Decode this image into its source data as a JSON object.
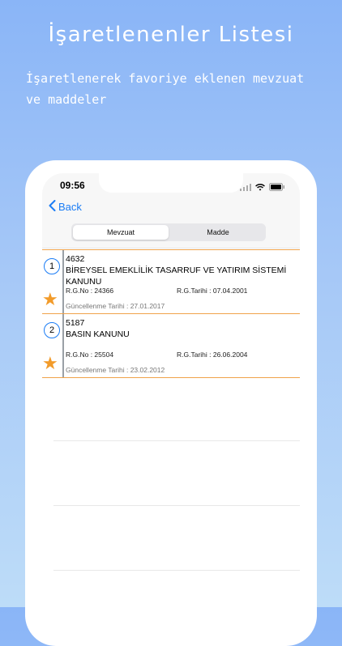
{
  "promo": {
    "title": "İşaretlenenler Listesi",
    "subtitle": "İşaretlenerek favoriye eklenen mevzuat ve maddeler"
  },
  "status_bar": {
    "time": "09:56"
  },
  "nav": {
    "back_label": "Back"
  },
  "segments": {
    "items": [
      "Mevzuat",
      "Madde"
    ],
    "selected": "Mevzuat"
  },
  "list": {
    "items": [
      {
        "index": "1",
        "number": "4632",
        "title": "BİREYSEL EMEKLİLİK TASARRUF VE YATIRIM SİSTEMİ KANUNU",
        "rg_no": "R.G.No : 24366",
        "rg_tarihi": "R.G.Tarihi : 07.04.2001",
        "updated": "Güncellenme Tarihi : 27.01.2017"
      },
      {
        "index": "2",
        "number": "5187",
        "title": "BASIN KANUNU",
        "rg_no": "R.G.No : 25504",
        "rg_tarihi": "R.G.Tarihi : 26.06.2004",
        "updated": "Güncellenme Tarihi : 23.02.2012"
      }
    ]
  },
  "colors": {
    "accent": "#1a7cf5",
    "star": "#f29b2a",
    "divider": "#f0a24a"
  }
}
